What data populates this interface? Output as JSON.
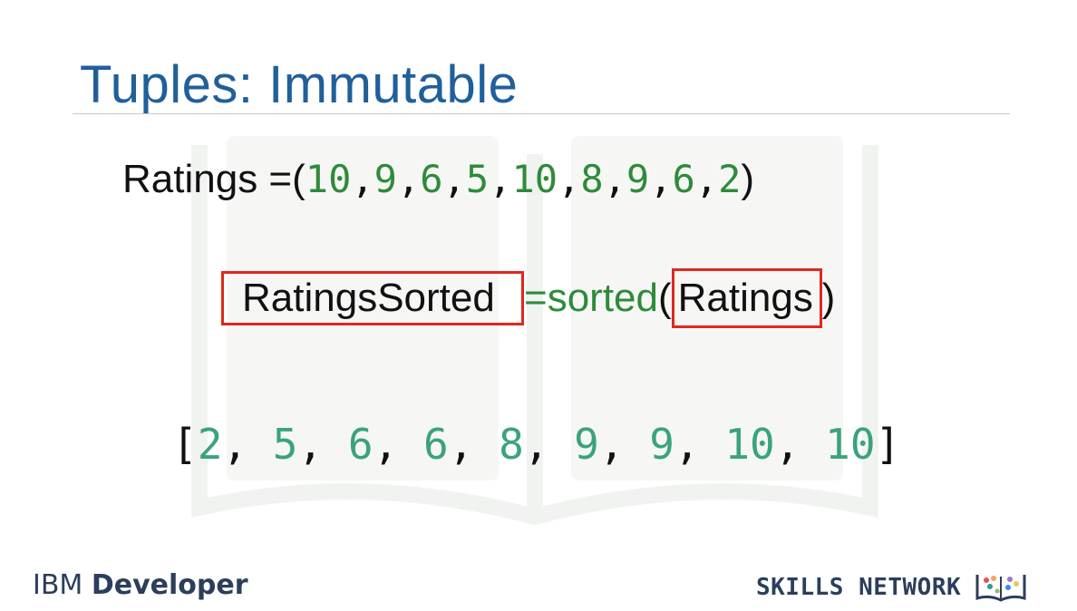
{
  "slide": {
    "title": "Tuples: Immutable"
  },
  "tuple_line": {
    "variable": "Ratings",
    "operator": "=",
    "open_paren": "(",
    "values": [
      "10",
      "9",
      "6",
      "5",
      "10",
      "8",
      "9",
      "6",
      "2"
    ],
    "close_paren": ")"
  },
  "sorted_line": {
    "target": "RatingsSorted",
    "equals": "=",
    "function": "sorted",
    "open_paren": "(",
    "argument": "Ratings",
    "close_paren": ")",
    "highlight_color": "#e0281e"
  },
  "result_line": {
    "open_bracket": "[",
    "values": [
      "2",
      "5",
      "6",
      "6",
      "8",
      "9",
      "9",
      "10",
      "10"
    ],
    "close_bracket": "]"
  },
  "footer": {
    "left_prefix": "IBM ",
    "left_bold": "Developer",
    "right_text": "SKILLS NETWORK"
  },
  "colors": {
    "title": "#215f9a",
    "code_value": "#2e8b3a",
    "result_value": "#3aa37a",
    "footer_text": "#2c3e5c"
  }
}
